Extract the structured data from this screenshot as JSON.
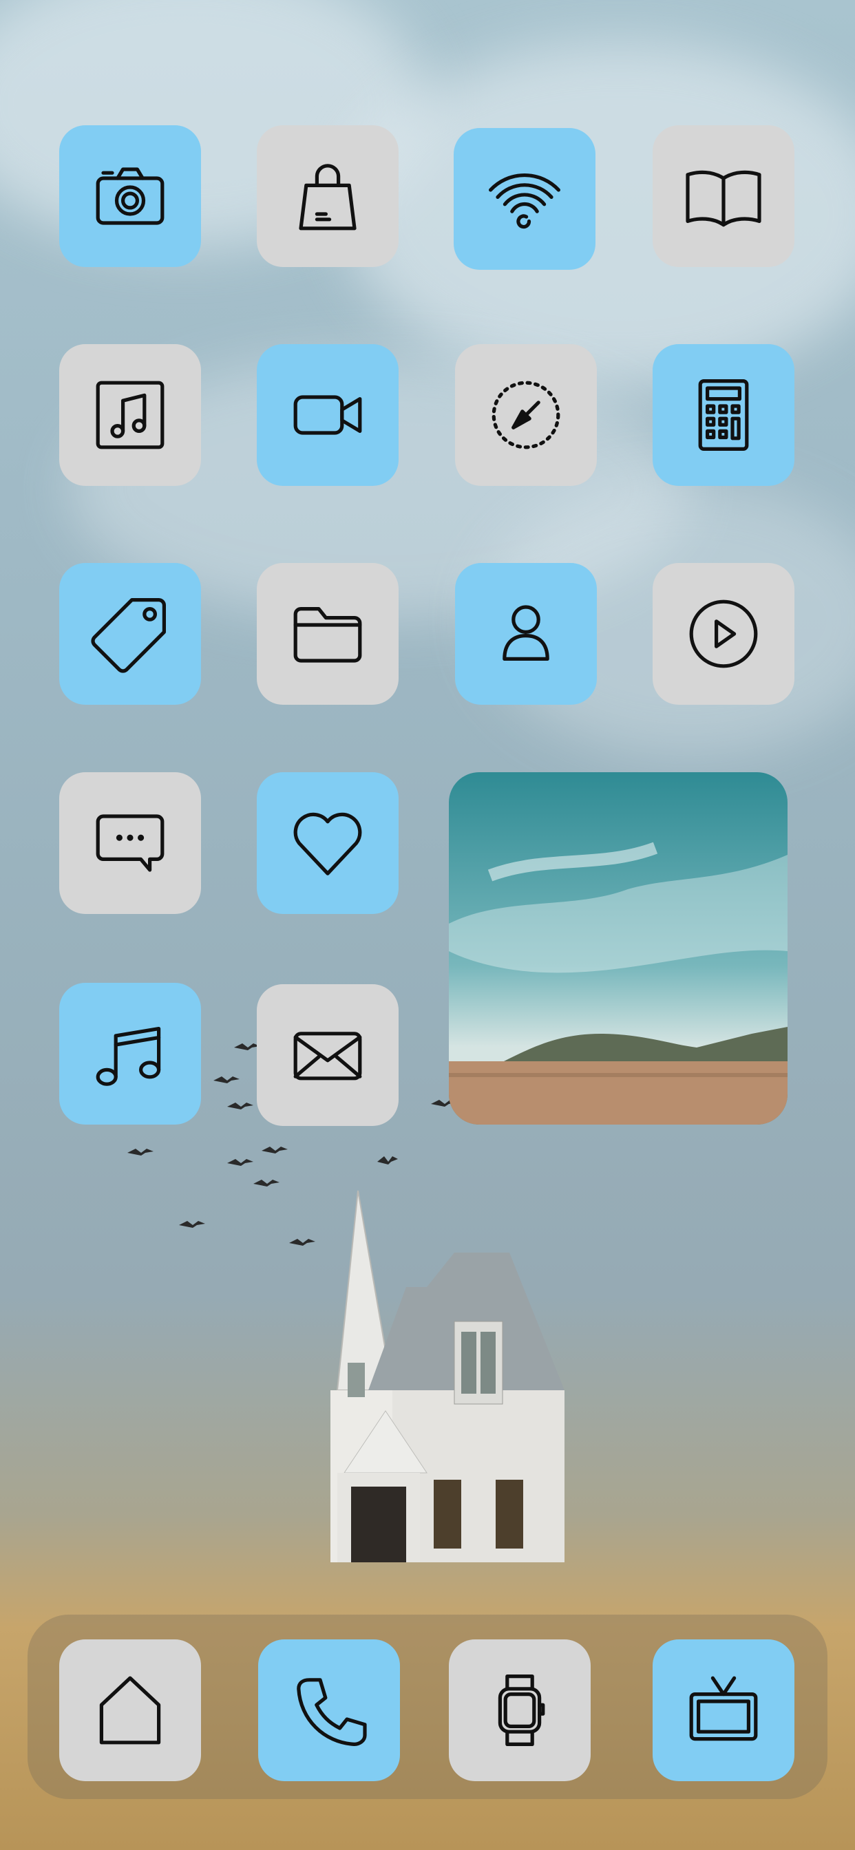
{
  "colors": {
    "accent_blue": "#81cdf3",
    "tile_gray": "#d6d6d6",
    "icon_line": "#111111"
  },
  "home_grid": [
    {
      "icon": "camera-icon",
      "style": "blue"
    },
    {
      "icon": "shopping-bag-icon",
      "style": "gray"
    },
    {
      "icon": "wifi-icon",
      "style": "blue"
    },
    {
      "icon": "book-icon",
      "style": "gray"
    },
    {
      "icon": "music-note-icon",
      "style": "gray"
    },
    {
      "icon": "video-camera-icon",
      "style": "blue"
    },
    {
      "icon": "compass-icon",
      "style": "gray"
    },
    {
      "icon": "calculator-icon",
      "style": "blue"
    },
    {
      "icon": "tag-icon",
      "style": "blue"
    },
    {
      "icon": "folder-icon",
      "style": "gray"
    },
    {
      "icon": "person-icon",
      "style": "blue"
    },
    {
      "icon": "play-icon",
      "style": "gray"
    },
    {
      "icon": "message-icon",
      "style": "gray"
    },
    {
      "icon": "heart-icon",
      "style": "blue"
    },
    {
      "icon": "music-icon",
      "style": "blue"
    },
    {
      "icon": "mail-icon",
      "style": "gray"
    }
  ],
  "widget": {
    "icon": "landscape-photo-icon"
  },
  "dock": [
    {
      "icon": "home-icon",
      "style": "gray"
    },
    {
      "icon": "phone-icon",
      "style": "blue"
    },
    {
      "icon": "watch-icon",
      "style": "gray"
    },
    {
      "icon": "tv-icon",
      "style": "blue"
    }
  ]
}
